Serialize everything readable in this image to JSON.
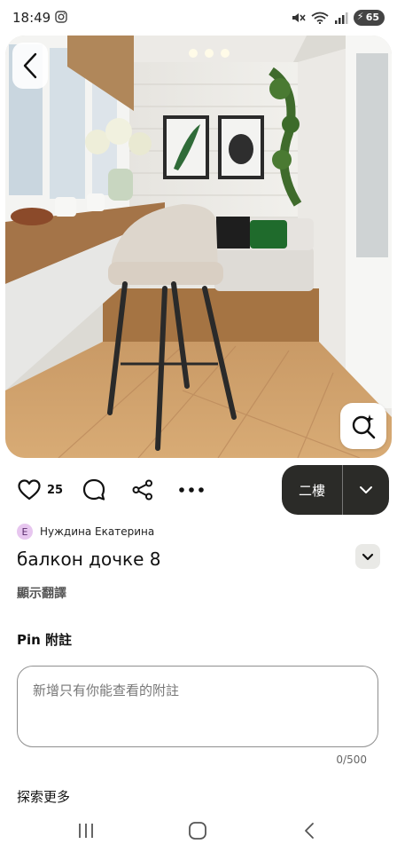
{
  "status_bar": {
    "time": "18:49",
    "battery": "65"
  },
  "pin": {
    "like_count": "25",
    "board_button": "二樓",
    "author_initial": "E",
    "author_name": "Нуждина Екатерина",
    "title": "балкон дочке 8",
    "translate_link": "顯示翻譯"
  },
  "note": {
    "heading": "Pin 附註",
    "placeholder": "新增只有你能查看的附註",
    "value": "",
    "counter": "0/500"
  },
  "explore": {
    "heading": "探索更多"
  },
  "icons": {
    "back": "chevron-left-icon",
    "lens": "visual-search-icon",
    "like": "heart-icon",
    "comment": "comment-icon",
    "share": "share-icon",
    "more": "more-icon",
    "board_dropdown": "chevron-down-icon",
    "title_toggle": "chevron-down-icon",
    "nav_recent": "recent-apps-icon",
    "nav_home": "home-icon",
    "nav_back": "back-icon"
  },
  "colors": {
    "board_button_bg": "#2b2b28",
    "avatar_bg": "#e7c6ef"
  }
}
